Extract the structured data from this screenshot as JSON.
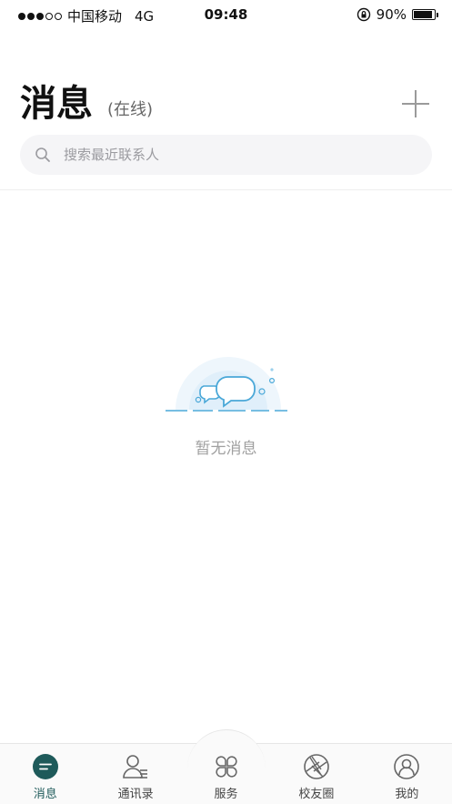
{
  "status_bar": {
    "carrier": "中国移动",
    "network": "4G",
    "time": "09:48",
    "battery_text": "90%",
    "battery_level": 0.9,
    "signal_bars_filled": 3,
    "signal_bars_total": 5,
    "icons": [
      "signal-icon",
      "rotation-lock-icon",
      "battery-icon"
    ]
  },
  "header": {
    "title": "消息",
    "status": "(在线)",
    "add_icon": "plus-icon"
  },
  "search": {
    "placeholder": "搜索最近联系人",
    "icon": "search-icon"
  },
  "empty_state": {
    "text": "暂无消息",
    "icon": "chat-bubbles-icon"
  },
  "tabs": [
    {
      "label": "消息",
      "icon": "message-icon",
      "active": true
    },
    {
      "label": "通讯录",
      "icon": "contacts-icon",
      "active": false
    },
    {
      "label": "服务",
      "icon": "services-icon",
      "active": false
    },
    {
      "label": "校友圈",
      "icon": "aperture-icon",
      "active": false
    },
    {
      "label": "我的",
      "icon": "profile-icon",
      "active": false
    }
  ],
  "colors": {
    "accent": "#1e5a5a",
    "illustration_blue": "#4aa8d8",
    "illustration_bg": "#e3f1fb",
    "muted_text": "#a0a0a0"
  }
}
